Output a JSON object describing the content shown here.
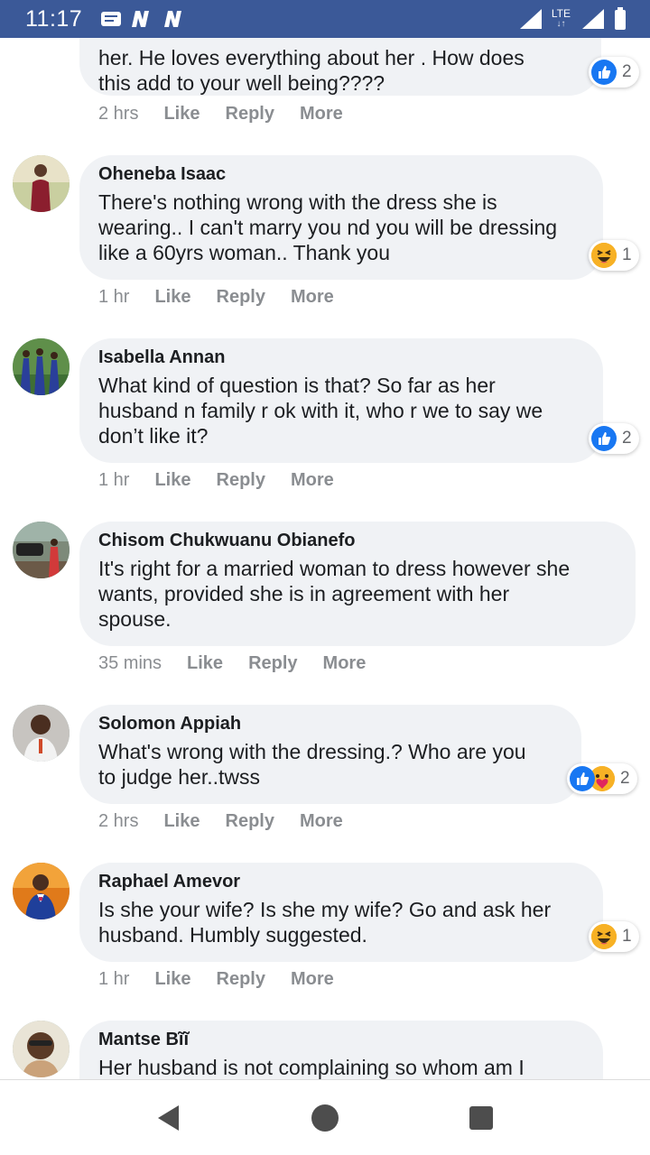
{
  "status_bar": {
    "time": "11:17",
    "network": "LTE",
    "icons": [
      "message-icon",
      "notification-n-icon",
      "notification-n-icon",
      "signal-icon",
      "signal-icon",
      "battery-icon"
    ]
  },
  "colors": {
    "status_bar_bg": "#3b5998",
    "bubble_bg": "#f0f2f5",
    "meta_text": "#8a8d91",
    "like_blue": "#1877f2",
    "haha_yellow": "#f7b125"
  },
  "comments": [
    {
      "name": "",
      "lines": [
        "her. He loves everything about her . How does",
        "this add to your well being????"
      ],
      "time": "2 hrs",
      "actions": [
        "Like",
        "Reply",
        "More"
      ],
      "reaction_count": "2",
      "reaction_icons": [
        "like-reaction-icon"
      ]
    },
    {
      "name": "Oheneba Isaac",
      "lines": [
        "There's nothing wrong with the dress she is",
        "wearing.. I can't marry you nd you will be dressing",
        "like a 60yrs woman.. Thank you"
      ],
      "time": "1 hr",
      "actions": [
        "Like",
        "Reply",
        "More"
      ],
      "reaction_count": "1",
      "reaction_icons": [
        "haha-reaction-icon"
      ]
    },
    {
      "name": "Isabella Annan",
      "lines": [
        "What kind of question is that? So far as her",
        "husband n family r ok with it, who r we to say we",
        "don’t like it?"
      ],
      "time": "1 hr",
      "actions": [
        "Like",
        "Reply",
        "More"
      ],
      "reaction_count": "2",
      "reaction_icons": [
        "like-reaction-icon"
      ]
    },
    {
      "name": "Chisom Chukwuanu Obianefo",
      "lines": [
        "It's right for a married woman to dress however she",
        "wants, provided she is in agreement with her",
        "spouse."
      ],
      "time": "35 mins",
      "actions": [
        "Like",
        "Reply",
        "More"
      ],
      "reaction_count": "",
      "reaction_icons": []
    },
    {
      "name": "Solomon Appiah",
      "lines": [
        "What's wrong with the dressing.? Who are you",
        "to judge her..twss"
      ],
      "time": "2 hrs",
      "actions": [
        "Like",
        "Reply",
        "More"
      ],
      "reaction_count": "2",
      "reaction_icons": [
        "like-reaction-icon",
        "care-reaction-icon"
      ]
    },
    {
      "name": "Raphael Amevor",
      "lines": [
        "Is she your wife? Is she my wife? Go and ask her",
        "husband. Humbly suggested."
      ],
      "time": "1 hr",
      "actions": [
        "Like",
        "Reply",
        "More"
      ],
      "reaction_count": "1",
      "reaction_icons": [
        "haha-reaction-icon"
      ]
    },
    {
      "name": "Mantse Bĩĩ",
      "lines": [
        "Her husband is not complaining so whom am I"
      ],
      "time": "",
      "actions": [],
      "reaction_count": "",
      "reaction_icons": []
    }
  ],
  "nav_bar": {
    "buttons": [
      "back-icon",
      "home-icon",
      "recents-icon"
    ]
  }
}
